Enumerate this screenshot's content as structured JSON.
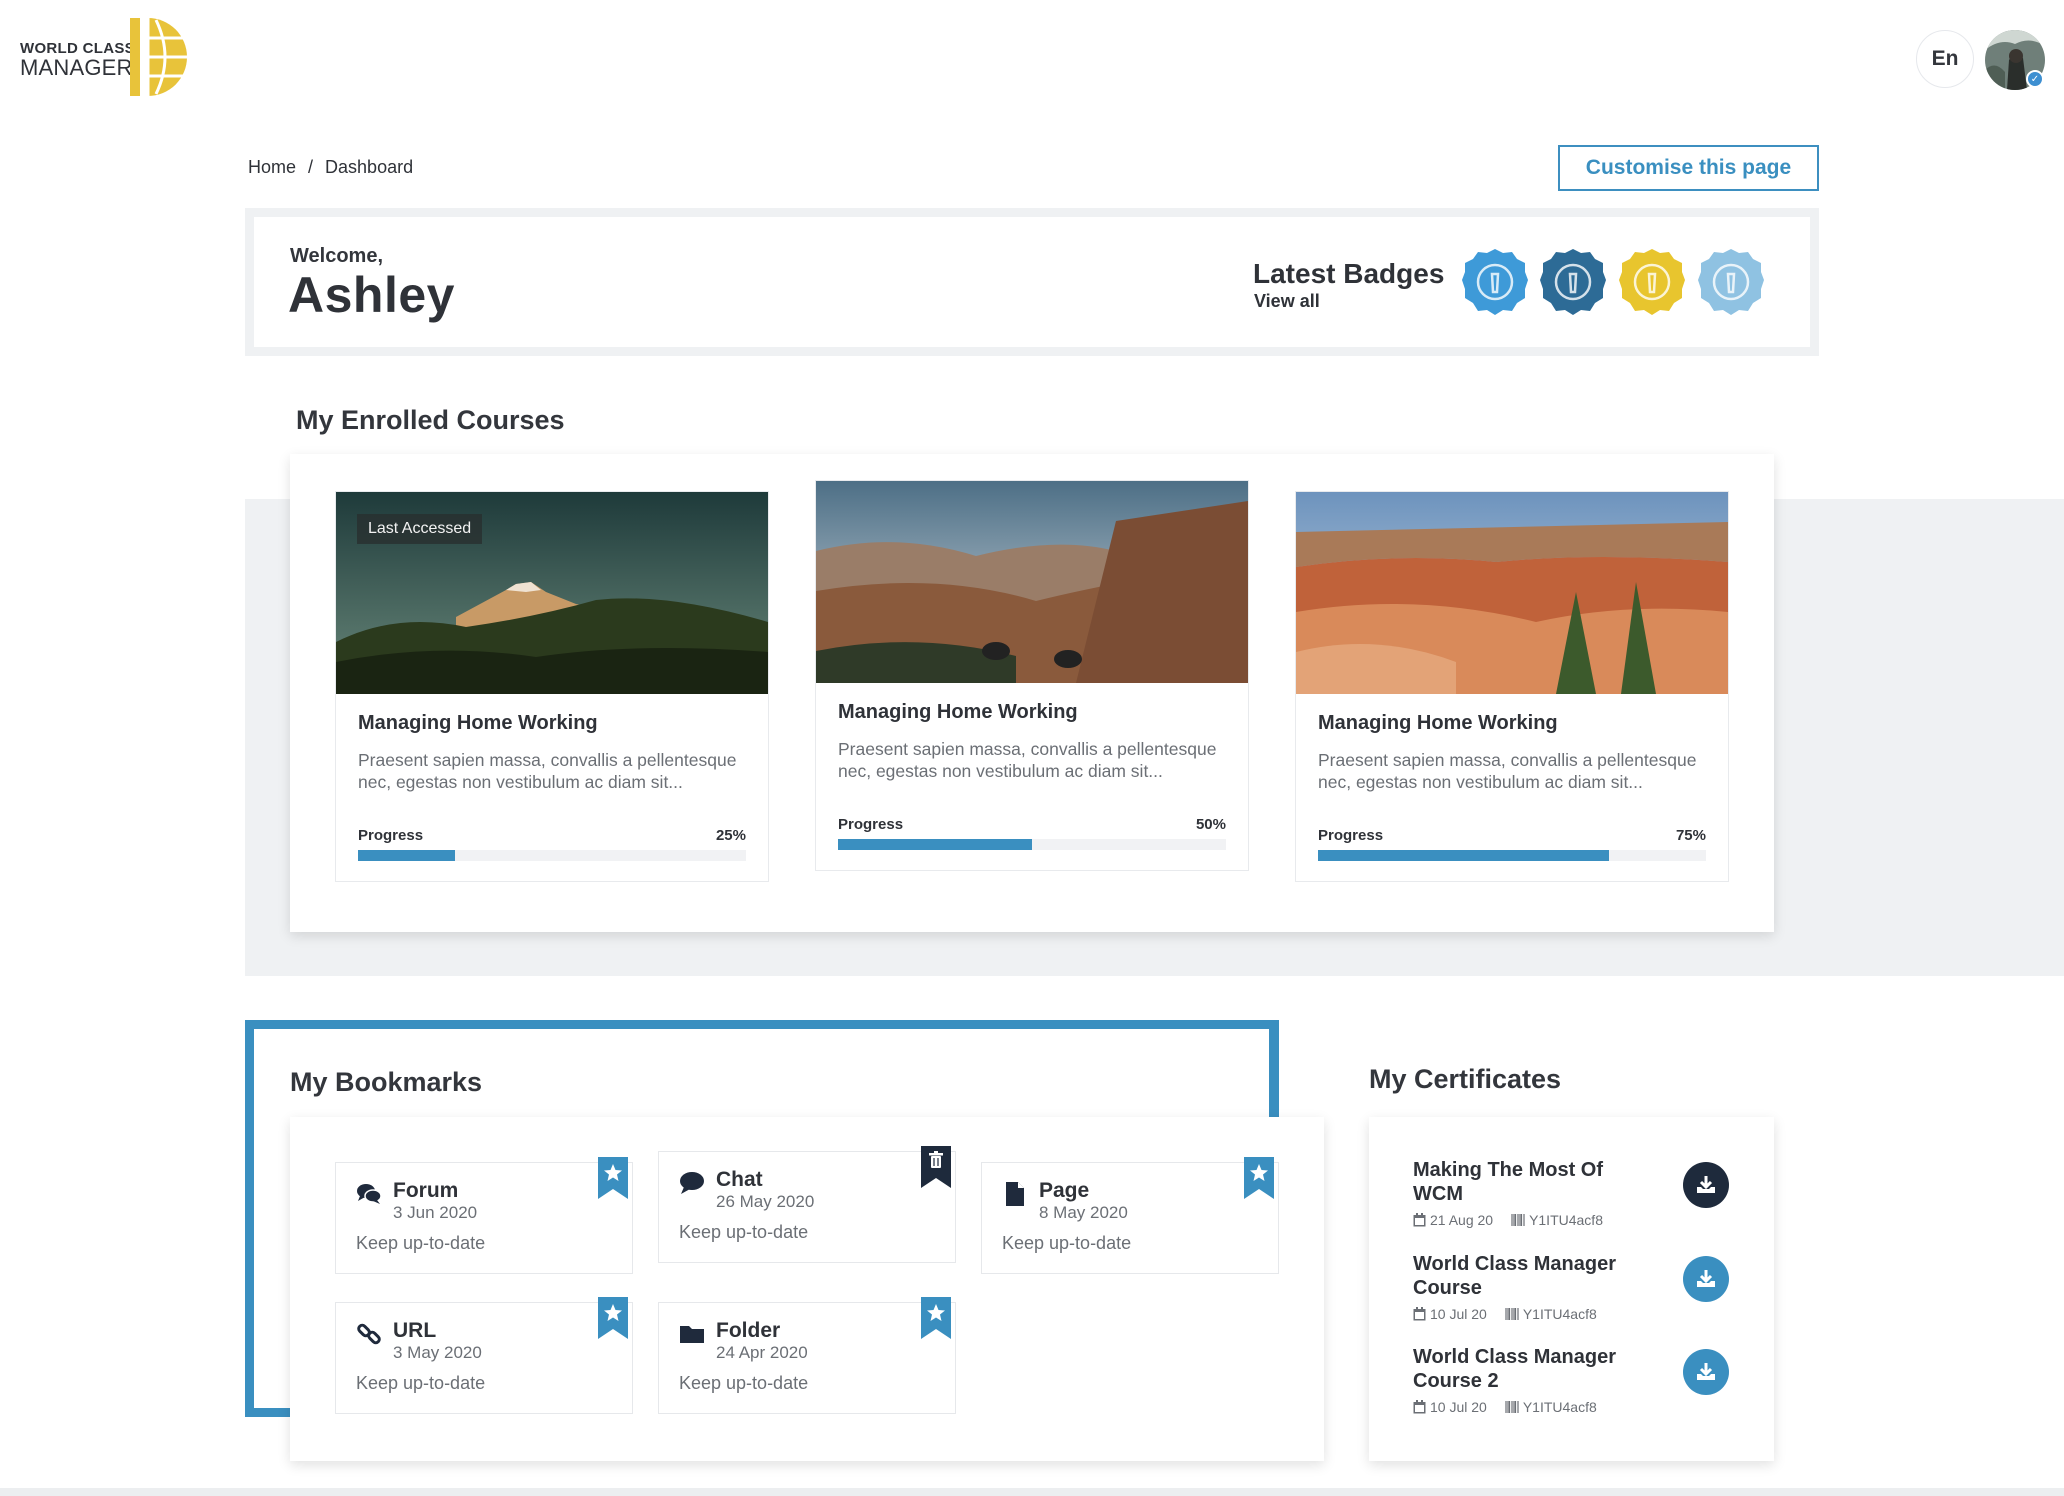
{
  "brand": {
    "logo_line1": "WORLD CLASS",
    "logo_line2": "MANAGER",
    "accent_color": "#3a8fc0",
    "logo_color": "#e8c33a"
  },
  "header": {
    "language": "En"
  },
  "breadcrumb": {
    "home": "Home",
    "separator": "/",
    "current": "Dashboard"
  },
  "customise_label": "Customise this page",
  "welcome": {
    "label": "Welcome,",
    "name": "Ashley"
  },
  "badges": {
    "title": "Latest Badges",
    "view_all": "View all",
    "items": [
      {
        "icon": "badge-icon",
        "color": "#3e9ad8"
      },
      {
        "icon": "badge-icon",
        "color": "#2d6b96"
      },
      {
        "icon": "badge-icon",
        "color": "#e8c52e"
      },
      {
        "icon": "badge-icon",
        "color": "#8fc2e2"
      }
    ]
  },
  "courses": {
    "title": "My Enrolled Courses",
    "last_accessed_label": "Last Accessed",
    "items": [
      {
        "title": "Managing Home Working",
        "description": "Praesent sapien massa, convallis a pellentesque nec, egestas non vestibulum ac diam sit...",
        "progress_label": "Progress",
        "progress_text": "25%",
        "progress": 0.25
      },
      {
        "title": "Managing Home Working",
        "description": "Praesent sapien massa, convallis a pellentesque nec, egestas non vestibulum ac diam sit...",
        "progress_label": "Progress",
        "progress_text": "50%",
        "progress": 0.5
      },
      {
        "title": "Managing Home Working",
        "description": "Praesent sapien massa, convallis a pellentesque nec, egestas non vestibulum ac diam sit...",
        "progress_label": "Progress",
        "progress_text": "75%",
        "progress": 0.75
      }
    ]
  },
  "bookmarks": {
    "title": "My Bookmarks",
    "items": [
      {
        "name": "Forum",
        "date": "3 Jun 2020",
        "description": "Keep up-to-date",
        "icon": "forum-icon",
        "flag": "bookmark-star-icon"
      },
      {
        "name": "Chat",
        "date": "26 May 2020",
        "description": "Keep up-to-date",
        "icon": "chat-icon",
        "flag": "bookmark-delete-icon"
      },
      {
        "name": "Page",
        "date": "8 May 2020",
        "description": "Keep up-to-date",
        "icon": "page-icon",
        "flag": "bookmark-star-icon"
      },
      {
        "name": "URL",
        "date": "3 May 2020",
        "description": "Keep up-to-date",
        "icon": "link-icon",
        "flag": "bookmark-star-icon"
      },
      {
        "name": "Folder",
        "date": "24 Apr 2020",
        "description": "Keep up-to-date",
        "icon": "folder-icon",
        "flag": "bookmark-star-icon"
      }
    ]
  },
  "certificates": {
    "title": "My Certificates",
    "items": [
      {
        "title": "Making The Most Of WCM",
        "date": "21 Aug 20",
        "code": "Y1ITU4acf8",
        "button_color": "#1e2a3c"
      },
      {
        "title": "World Class Manager Course",
        "date": "10 Jul 20",
        "code": "Y1ITU4acf8",
        "button_color": "#3a8fc0"
      },
      {
        "title": "World Class Manager Course 2",
        "date": "10 Jul 20",
        "code": "Y1ITU4acf8",
        "button_color": "#3a8fc0"
      }
    ]
  }
}
